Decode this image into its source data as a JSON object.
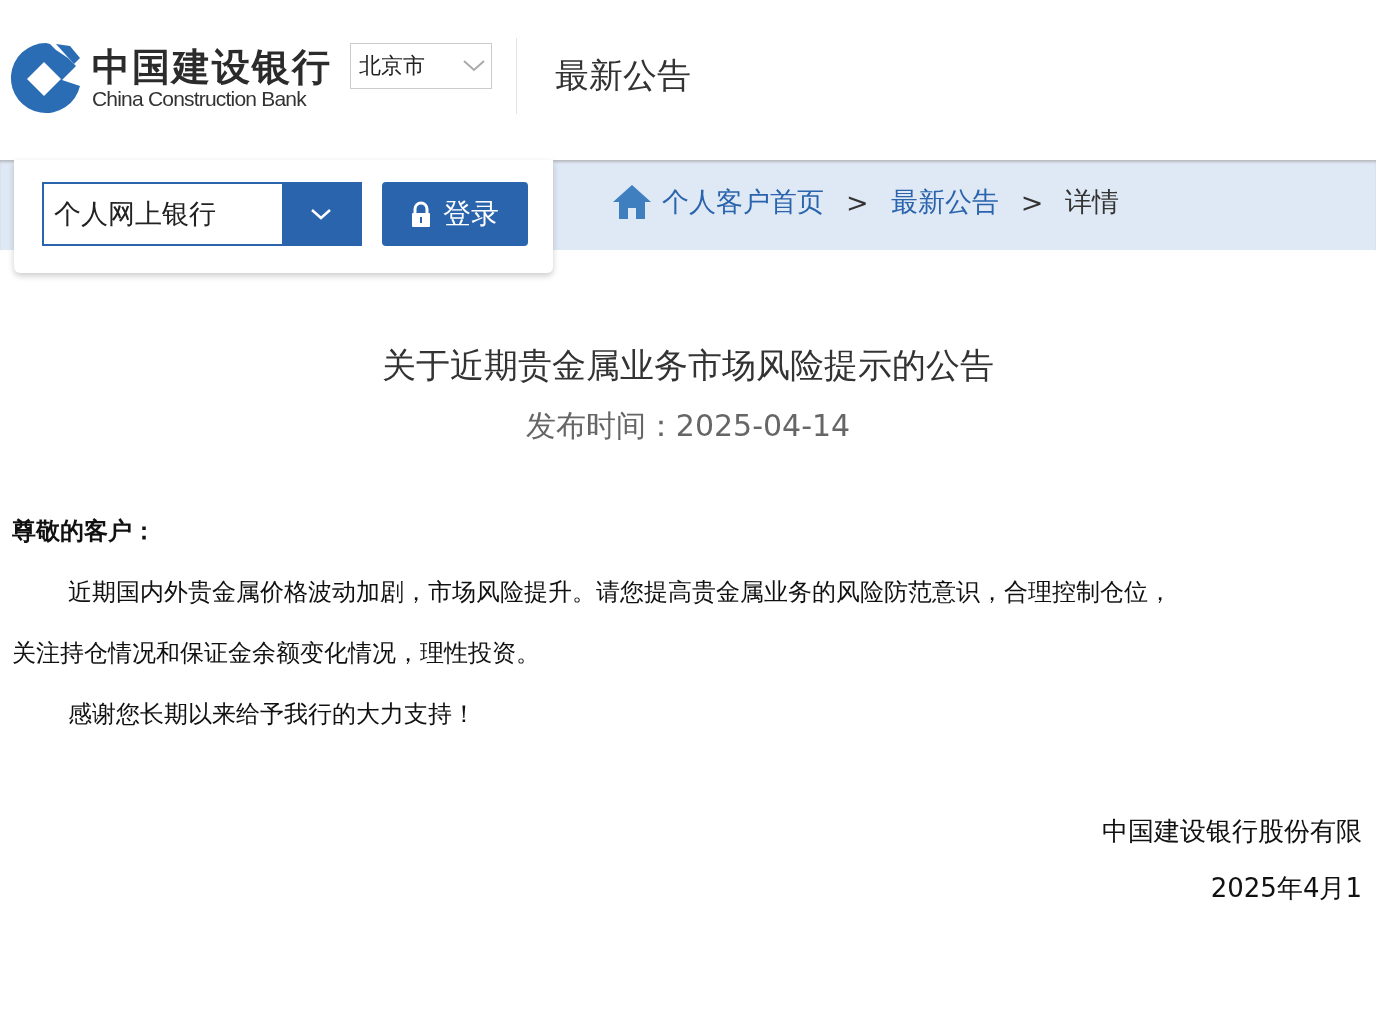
{
  "logo": {
    "name_cn": "中国建设银行",
    "name_en": "China Construction Bank"
  },
  "region_select": {
    "value": "北京市"
  },
  "header_title": "最新公告",
  "login": {
    "channel_select": {
      "value": "个人网上银行"
    },
    "button": "登录"
  },
  "breadcrumb": [
    {
      "label": "个人客户首页",
      "kind": "link"
    },
    {
      "label": ">",
      "kind": "separator"
    },
    {
      "label": "最新公告",
      "kind": "link"
    },
    {
      "label": ">",
      "kind": "separator"
    },
    {
      "label": "详情",
      "kind": "current"
    }
  ],
  "article": {
    "title": "关于近期贵金属业务市场风险提示的公告",
    "published": "发布时间：2025-04-14",
    "greeting": "尊敬的客户：",
    "lines": [
      {
        "text": "近期国内外贵金属价格波动加剧，市场风险提升。请您提高贵金属业务的风险防范意识，合理控制仓位，",
        "indent": true
      },
      {
        "text": "关注持仓情况和保证金余额变化情况，理性投资。",
        "indent": false
      },
      {
        "text": "感谢您长期以来给予我行的大力支持！",
        "indent": true
      }
    ],
    "signature": "中国建设银行股份有限",
    "date": "2025年4月1"
  }
}
